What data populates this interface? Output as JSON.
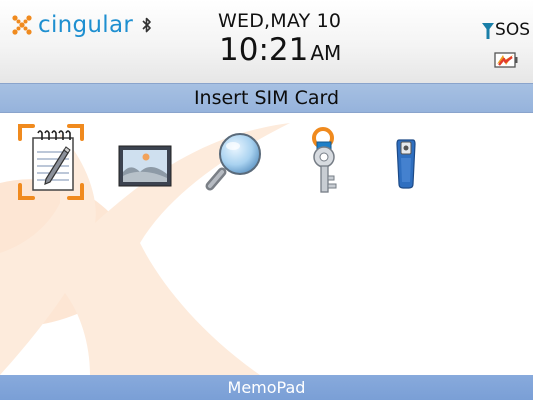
{
  "status_bar": {
    "carrier_name": "cingular",
    "carrier_logo_icon": "cingular-x-logo-icon",
    "bluetooth_icon": "bluetooth-icon",
    "date": "WED,MAY 10",
    "time": "10:21",
    "ampm": "AM",
    "signal_text": "SOS",
    "signal_icon": "antenna-icon",
    "battery_icon": "battery-charging-icon"
  },
  "title_bar": {
    "text": "Insert SIM Card"
  },
  "apps": [
    {
      "icon": "memopad-notepad-icon",
      "selected": true
    },
    {
      "icon": "pictures-image-icon",
      "selected": false
    },
    {
      "icon": "search-magnifier-icon",
      "selected": false
    },
    {
      "icon": "password-keeper-key-icon",
      "selected": false
    },
    {
      "icon": "blue-device-icon",
      "selected": false
    }
  ],
  "bottom_bar": {
    "selected_app_label": "MemoPad"
  },
  "colors": {
    "carrier_blue": "#1e8fd0",
    "title_bar": "#9bb6de",
    "bottom_bar": "#7fa3d8",
    "selection_orange": "#f08a1e",
    "swoosh_peach": "#fde2cf"
  }
}
